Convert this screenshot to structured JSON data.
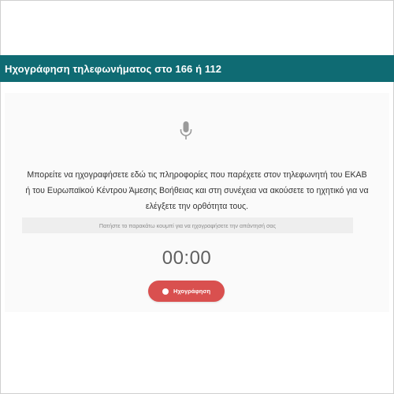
{
  "header": {
    "title": "Ηχογράφηση τηλεφωνήματος στο 166 ή 112"
  },
  "main": {
    "mic_icon": "microphone-icon",
    "info_text": "Μπορείτε να ηχογραφήσετε εδώ τις πληροφορίες που παρέχετε στον τηλεφωνητή του ΕΚΑΒ ή του Ευρωπαϊκού Κέντρου Άμεσης Βοήθειας και στη συνέχεια να ακούσετε το ηχητικό για να ελέγξετε την ορθότητα τους.",
    "hint_text": "Πατήστε το παρακάτω κουμπί για να ηχογραφήσετε την απάντησή σας",
    "timer": "00:00",
    "record_button_label": "Ηχογράφηση"
  },
  "colors": {
    "header_bg": "#0f6b73",
    "record_button": "#d9504f",
    "panel_bg": "#fafafa"
  }
}
